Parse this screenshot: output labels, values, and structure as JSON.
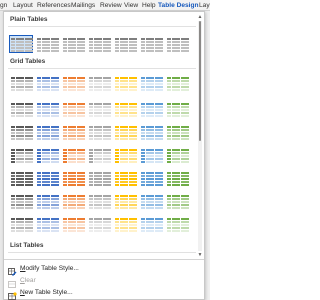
{
  "ribbon": {
    "tabs": [
      {
        "label": "gn",
        "active": false
      },
      {
        "label": "Layout",
        "active": false
      },
      {
        "label": "References",
        "active": false
      },
      {
        "label": "Mailings",
        "active": false
      },
      {
        "label": "Review",
        "active": false
      },
      {
        "label": "View",
        "active": false
      },
      {
        "label": "Help",
        "active": false
      },
      {
        "label": "Table Design",
        "active": true
      },
      {
        "label": "Layout",
        "active": false
      }
    ]
  },
  "gallery": {
    "sections": [
      {
        "title": "Plain Tables"
      },
      {
        "title": "Grid Tables"
      },
      {
        "title": "List Tables"
      }
    ],
    "accent_colors": {
      "black": "#595959",
      "blue": "#4472c4",
      "orange": "#ed7d31",
      "gray": "#a5a5a5",
      "gold": "#ffc000",
      "lightblue": "#5b9bd5",
      "green": "#70ad47"
    }
  },
  "menu": {
    "items": [
      {
        "pre": "",
        "underline": "M",
        "post": "odify Table Style...",
        "icon": "modify-table-style-icon",
        "enabled": true
      },
      {
        "pre": "",
        "underline": "C",
        "post": "lear",
        "icon": "clear-table-icon",
        "enabled": false
      },
      {
        "pre": "",
        "underline": "N",
        "post": "ew Table Style...",
        "icon": "new-table-style-icon",
        "enabled": true
      }
    ]
  }
}
